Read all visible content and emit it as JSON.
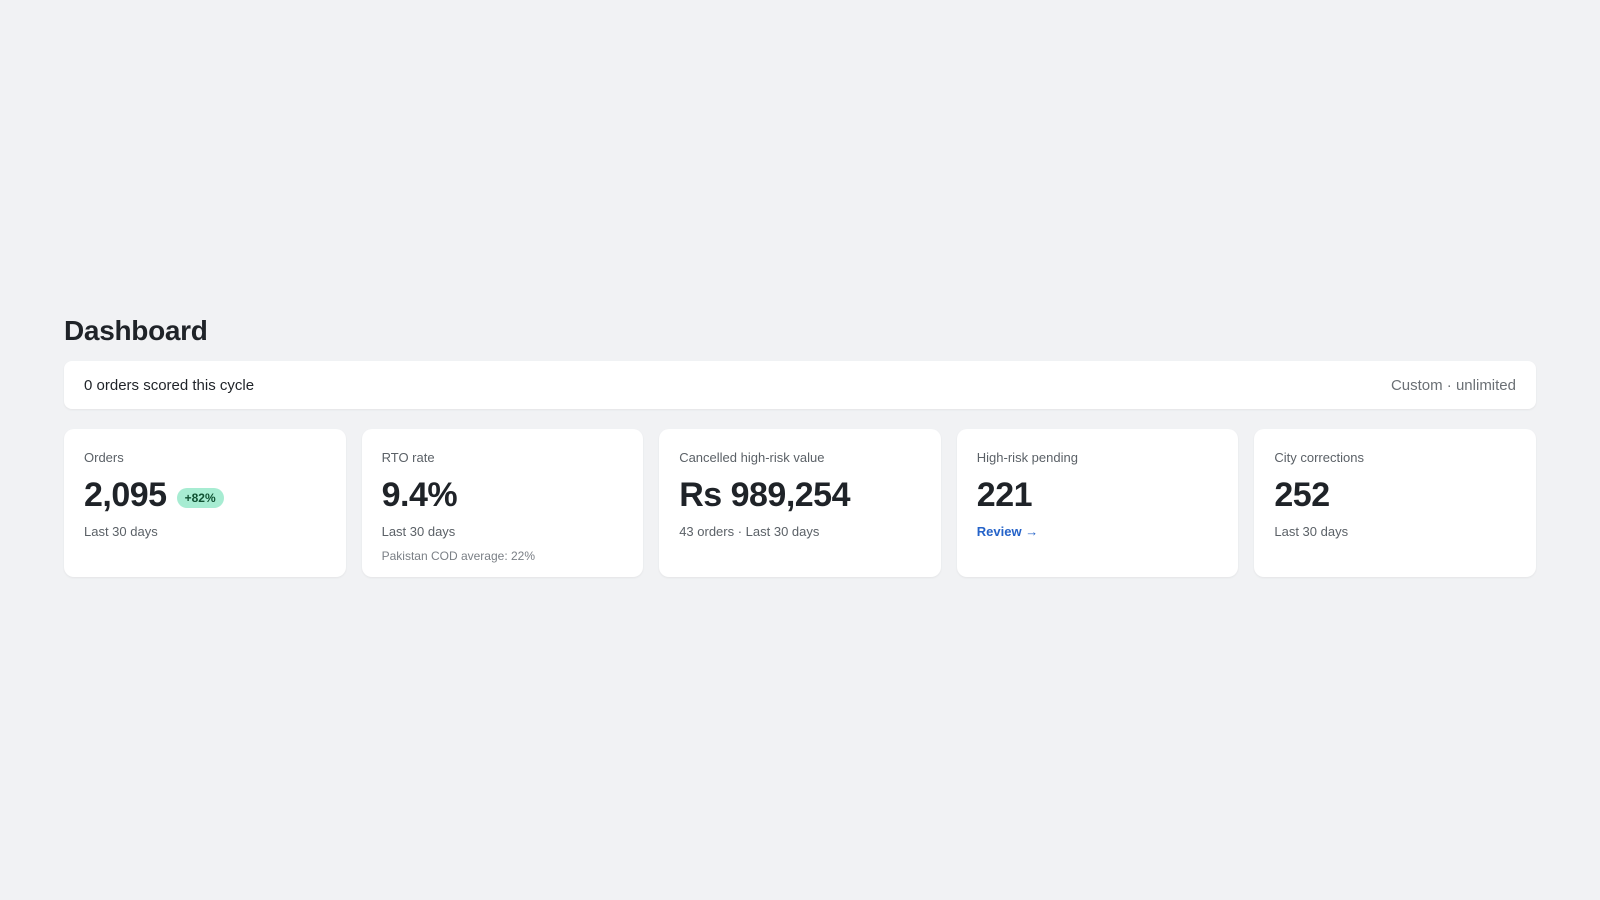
{
  "page": {
    "title": "Dashboard"
  },
  "usage": {
    "scored_text": "0 orders scored this cycle",
    "plan_text": "Custom · unlimited"
  },
  "cards": {
    "orders": {
      "label": "Orders",
      "value": "2,095",
      "badge": "+82%",
      "sub": "Last 30 days"
    },
    "rto": {
      "label": "RTO rate",
      "value": "9.4%",
      "sub": "Last 30 days",
      "note": "Pakistan COD average: 22%"
    },
    "cancelled": {
      "label": "Cancelled high-risk value",
      "value": "Rs 989,254",
      "sub": "43 orders · Last 30 days"
    },
    "pending": {
      "label": "High-risk pending",
      "value": "221",
      "link": "Review →"
    },
    "city": {
      "label": "City corrections",
      "value": "252",
      "sub": "Last 30 days"
    }
  },
  "colors": {
    "background": "#f1f2f4",
    "card": "#ffffff",
    "badge_bg": "#a7ecd2",
    "badge_text": "#0f5132",
    "link": "#2563c9"
  }
}
